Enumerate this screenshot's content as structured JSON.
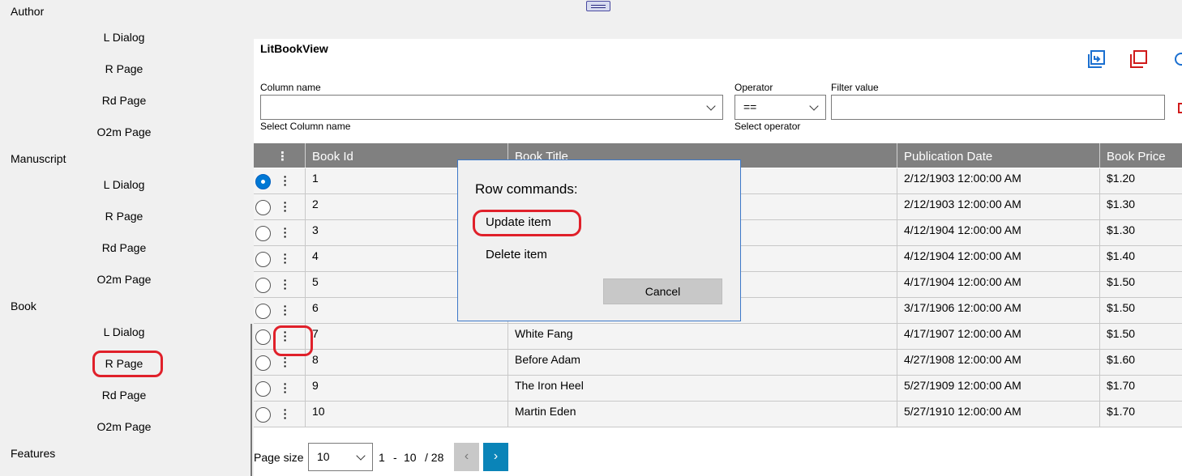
{
  "sidebar": {
    "groups": [
      {
        "label": "Author",
        "items": [
          "L Dialog",
          "R Page",
          "Rd Page",
          "O2m Page"
        ]
      },
      {
        "label": "Manuscript",
        "items": [
          "L Dialog",
          "R Page",
          "Rd Page",
          "O2m Page"
        ]
      },
      {
        "label": "Book",
        "items": [
          "L Dialog",
          "R Page",
          "Rd Page",
          "O2m Page"
        ]
      },
      {
        "label": "Features"
      }
    ]
  },
  "view": {
    "title": "LitBookView",
    "icons": [
      "export-icon",
      "copy-icon",
      "refresh-icon"
    ]
  },
  "filter": {
    "column_label": "Column name",
    "column_value": "",
    "column_hint": "Select Column name",
    "operator_label": "Operator",
    "operator_value": "==",
    "operator_hint": "Select operator",
    "value_label": "Filter value",
    "value_value": ""
  },
  "grid": {
    "columns": [
      "Book Id",
      "Book Title",
      "Publication Date",
      "Book Price"
    ],
    "menu_icon": "⋮",
    "rows": [
      {
        "id": "1",
        "title": "",
        "date": "2/12/1903 12:00:00 AM",
        "price": "$1.20",
        "selected": true
      },
      {
        "id": "2",
        "title": "",
        "date": "2/12/1903 12:00:00 AM",
        "price": "$1.30"
      },
      {
        "id": "3",
        "title": "",
        "date": "4/12/1904 12:00:00 AM",
        "price": "$1.30"
      },
      {
        "id": "4",
        "title": "",
        "date": "4/12/1904 12:00:00 AM",
        "price": "$1.40"
      },
      {
        "id": "5",
        "title": "",
        "date": "4/17/1904 12:00:00 AM",
        "price": "$1.50"
      },
      {
        "id": "6",
        "title": "",
        "date": "3/17/1906 12:00:00 AM",
        "price": "$1.50"
      },
      {
        "id": "7",
        "title": "White Fang",
        "date": "4/17/1907 12:00:00 AM",
        "price": "$1.50"
      },
      {
        "id": "8",
        "title": "Before Adam",
        "date": "4/27/1908 12:00:00 AM",
        "price": "$1.60"
      },
      {
        "id": "9",
        "title": "The Iron Heel",
        "date": "5/27/1909 12:00:00 AM",
        "price": "$1.70"
      },
      {
        "id": "10",
        "title": "Martin Eden",
        "date": "5/27/1910 12:00:00 AM",
        "price": "$1.70"
      }
    ]
  },
  "pager": {
    "size_label": "Page size",
    "size_value": "10",
    "range_start": "1",
    "range_sep": "-",
    "range_end": "10",
    "total": "/ 28",
    "prev": "‹",
    "next": "›"
  },
  "dialog": {
    "title": "Row commands:",
    "update": "Update item",
    "delete": "Delete item",
    "cancel": "Cancel"
  },
  "colors": {
    "accent": "#0078d4",
    "annotation": "#e0202a",
    "header_bg": "#808080",
    "pager_next": "#0a84b8"
  }
}
